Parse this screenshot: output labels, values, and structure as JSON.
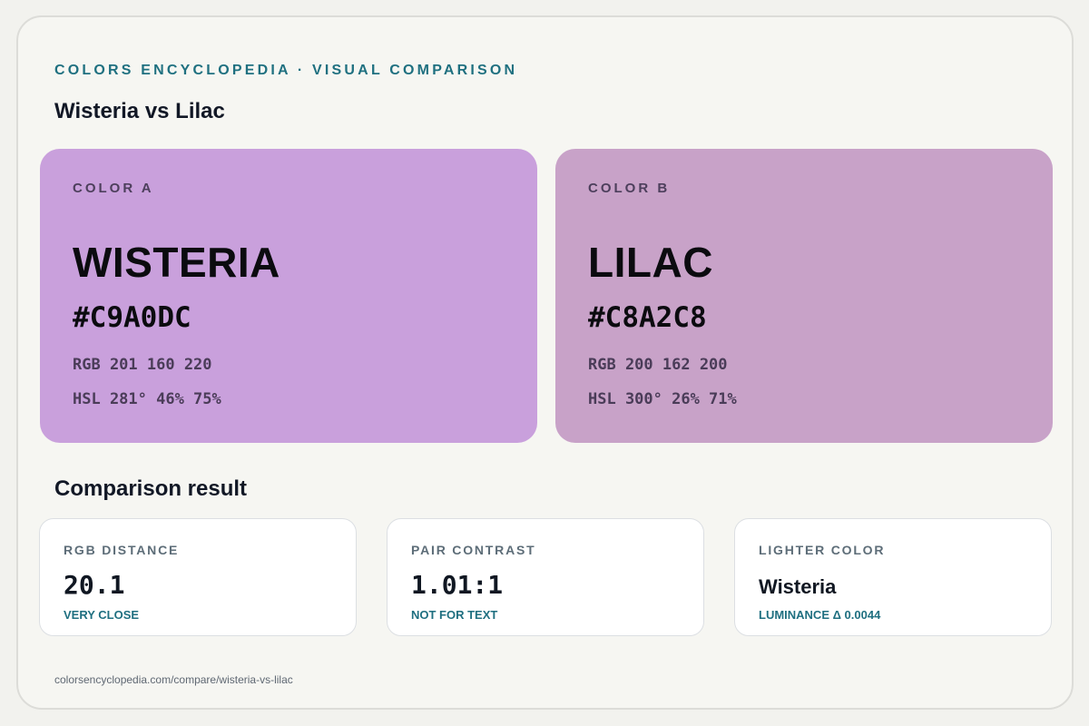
{
  "header": {
    "eyebrow": "COLORS ENCYCLOPEDIA · VISUAL COMPARISON",
    "title": "Wisteria vs Lilac"
  },
  "colors": [
    {
      "role": "COLOR A",
      "name": "WISTERIA",
      "hex": "#C9A0DC",
      "rgb": "RGB 201 160 220",
      "hsl": "HSL 281° 46% 75%",
      "swatch_color": "#C9A0DC"
    },
    {
      "role": "COLOR B",
      "name": "LILAC",
      "hex": "#C8A2C8",
      "rgb": "RGB 200 162 200",
      "hsl": "HSL 300° 26% 71%",
      "swatch_color": "#C8A2C8"
    }
  ],
  "comparison": {
    "title": "Comparison result",
    "cards": [
      {
        "label": "RGB DISTANCE",
        "value": "20.1",
        "note": "VERY CLOSE"
      },
      {
        "label": "PAIR CONTRAST",
        "value": "1.01:1",
        "note": "NOT FOR TEXT"
      },
      {
        "label": "LIGHTER COLOR",
        "value": "Wisteria",
        "note": "LUMINANCE Δ 0.0044"
      }
    ]
  },
  "footer": {
    "url": "colorsencyclopedia.com/compare/wisteria-vs-lilac"
  },
  "theme": {
    "accent": "#1F7080",
    "background": "#F6F6F2"
  }
}
